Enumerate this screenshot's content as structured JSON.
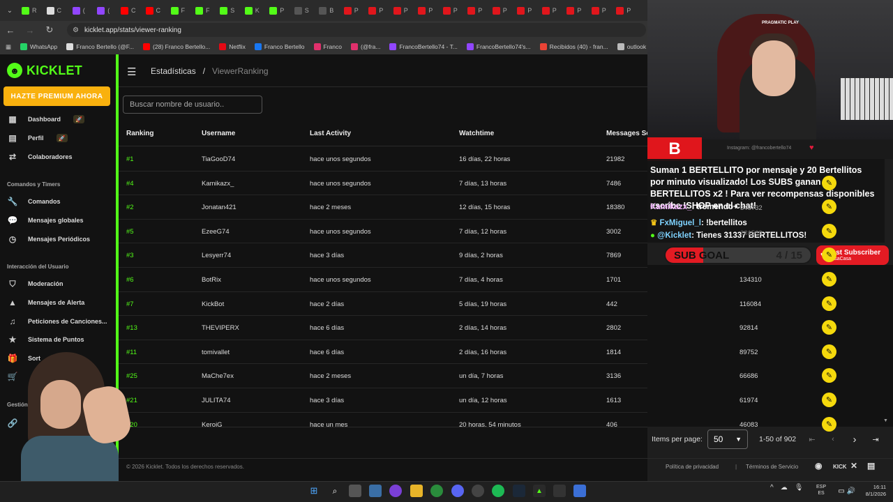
{
  "browser": {
    "tabs": [
      {
        "label": "R",
        "color": "#53fc18"
      },
      {
        "label": "C",
        "color": "#dddddd"
      },
      {
        "label": "(",
        "color": "#9146ff"
      },
      {
        "label": "(",
        "color": "#9146ff"
      },
      {
        "label": "C",
        "color": "#ff0000"
      },
      {
        "label": "C",
        "color": "#ff0000"
      },
      {
        "label": "F",
        "color": "#53fc18"
      },
      {
        "label": "F",
        "color": "#53fc18"
      },
      {
        "label": "S",
        "color": "#53fc18"
      },
      {
        "label": "K",
        "color": "#53fc18"
      },
      {
        "label": "P",
        "color": "#53fc18"
      },
      {
        "label": "S",
        "color": "#555555"
      },
      {
        "label": "B",
        "color": "#555555"
      },
      {
        "label": "P",
        "color": "#e0161c"
      },
      {
        "label": "P",
        "color": "#e0161c"
      },
      {
        "label": "P",
        "color": "#e0161c"
      },
      {
        "label": "P",
        "color": "#e0161c"
      },
      {
        "label": "P",
        "color": "#e0161c"
      },
      {
        "label": "P",
        "color": "#e0161c"
      },
      {
        "label": "P",
        "color": "#e0161c"
      },
      {
        "label": "P",
        "color": "#e0161c"
      },
      {
        "label": "P",
        "color": "#e0161c"
      },
      {
        "label": "P",
        "color": "#e0161c"
      },
      {
        "label": "P",
        "color": "#e0161c"
      },
      {
        "label": "P",
        "color": "#e0161c"
      }
    ],
    "url": "kicklet.app/stats/viewer-ranking",
    "bookmarks": [
      {
        "label": "WhatsApp",
        "color": "#25d366"
      },
      {
        "label": "Franco Bertello (@F...",
        "color": "#dddddd"
      },
      {
        "label": "(28) Franco Bertello...",
        "color": "#ff0000"
      },
      {
        "label": "Netflix",
        "color": "#e50914"
      },
      {
        "label": "Franco Bertello",
        "color": "#1877f2"
      },
      {
        "label": "Franco",
        "color": "#e1306c"
      },
      {
        "label": "(@fra...",
        "color": "#e1306c"
      },
      {
        "label": "FrancoBertello74 - T...",
        "color": "#9146ff"
      },
      {
        "label": "FrancoBertello74's...",
        "color": "#9146ff"
      },
      {
        "label": "Recibidos (40) - fran...",
        "color": "#ea4335"
      },
      {
        "label": "outlook",
        "color": "#bbbbbb"
      },
      {
        "label": "Aler",
        "color": "#53fc18"
      }
    ]
  },
  "app": {
    "logo": "KICKLET",
    "premium": "HAZTE PREMIUM AHORA",
    "nav": {
      "dashboard": "Dashboard",
      "perfil": "Perfil",
      "colaboradores": "Colaboradores",
      "sec_comandos": "Comandos y Timers",
      "comandos": "Comandos",
      "mensajes_globales": "Mensajes globales",
      "mensajes_periodicos": "Mensajes Periódicos",
      "sec_interaccion": "Interacción del Usuario",
      "moderacion": "Moderación",
      "mensajes_alerta": "Mensajes de Alerta",
      "peticiones": "Peticiones de Canciones...",
      "sistema_puntos": "Sistema de Puntos",
      "sorteos": "Sort",
      "sec_gestion": "Gestión"
    },
    "breadcrumb": {
      "parent": "Estadísticas",
      "sep": "/",
      "current": "ViewerRanking"
    },
    "search_placeholder": "Buscar nombre de usuario..",
    "columns": {
      "ranking": "Ranking",
      "username": "Username",
      "last_activity": "Last Activity",
      "watchtime": "Watchtime",
      "messages": "Messages Se"
    },
    "rows": [
      {
        "rank": "#1",
        "user": "TiaGooD74",
        "activity": "hace unos segundos",
        "watch": "16 días, 22 horas",
        "msgs": "21982",
        "points": ""
      },
      {
        "rank": "#4",
        "user": "Kamikazx_",
        "activity": "hace unos segundos",
        "watch": "7 días, 13 horas",
        "msgs": "7486",
        "points": ""
      },
      {
        "rank": "#2",
        "user": "Jonatan421",
        "activity": "hace 2 meses",
        "watch": "12 días, 15 horas",
        "msgs": "18380",
        "points": ""
      },
      {
        "rank": "#5",
        "user": "EzeeG74",
        "activity": "hace unos segundos",
        "watch": "7 días, 12 horas",
        "msgs": "3002",
        "points": ""
      },
      {
        "rank": "#3",
        "user": "Lesyerr74",
        "activity": "hace 3 días",
        "watch": "9 días, 2 horas",
        "msgs": "7869",
        "points": ""
      },
      {
        "rank": "#6",
        "user": "BotRix",
        "activity": "hace unos segundos",
        "watch": "7 días, 4 horas",
        "msgs": "1701",
        "points": "134310"
      },
      {
        "rank": "#7",
        "user": "KickBot",
        "activity": "hace 2 días",
        "watch": "5 días, 19 horas",
        "msgs": "442",
        "points": "116084"
      },
      {
        "rank": "#13",
        "user": "THEVIPERX",
        "activity": "hace 6 días",
        "watch": "2 días, 14 horas",
        "msgs": "2802",
        "points": "92814"
      },
      {
        "rank": "#11",
        "user": "tomivallet",
        "activity": "hace 6 días",
        "watch": "2 días, 16 horas",
        "msgs": "1814",
        "points": "89752"
      },
      {
        "rank": "#25",
        "user": "MaChe7ex",
        "activity": "hace 2 meses",
        "watch": "un día, 7 horas",
        "msgs": "3136",
        "points": "66686"
      },
      {
        "rank": "#21",
        "user": "JULITA74",
        "activity": "hace 3 días",
        "watch": "un día, 12 horas",
        "msgs": "1613",
        "points": "61974"
      },
      {
        "rank": "#20",
        "user": "KeroiG",
        "activity": "hace un mes",
        "watch": "20 horas, 54 minutos",
        "msgs": "406",
        "points": "46083"
      }
    ],
    "pagination": {
      "label": "Items per page:",
      "value": "50",
      "range": "1-50 of 902"
    },
    "footer": {
      "copyright": "© 2026 Kicklet. Todos los derechos reservados.",
      "privacy": "Política de privacidad",
      "sep": "|",
      "terms": "Términos de Servicio",
      "kick": "KICK"
    }
  },
  "stream": {
    "brand_letter": "B",
    "instagram": "Instagram: @francobertello74",
    "cap_logo": "PRAGMATIC PLAY",
    "chat_notice": "Suman 1 BERTELLITO por mensaje y 20 Bertellitos por minuto visualizado! Los SUBS ganan BERTELLITOS x2 ! Para ver recompensas disponibles escribe !SHOP en el chat!",
    "messages": [
      {
        "user": "Kamikazx_",
        "text": ": tremendo+",
        "user_color": "#f4b3ff"
      },
      {
        "user": "FxMiguel_l",
        "text": ": !bertellitos",
        "user_color": "#7fd3ff"
      },
      {
        "user": "@Kicklet",
        "text": ": Tienes 31337 BERTELLITOS!",
        "user_color": "#7fd3ff"
      }
    ],
    "hidden_values": [
      "348732",
      "281569"
    ],
    "subgoal": {
      "label": "SUB GOAL",
      "count": "4 / 15",
      "progress": 0.27
    },
    "lastsub": {
      "title": "Last Subscriber",
      "name": "MasaCasa"
    }
  },
  "taskbar": {
    "lang": "ESP\nES",
    "time": "16:11",
    "date": "8/1/2026"
  }
}
